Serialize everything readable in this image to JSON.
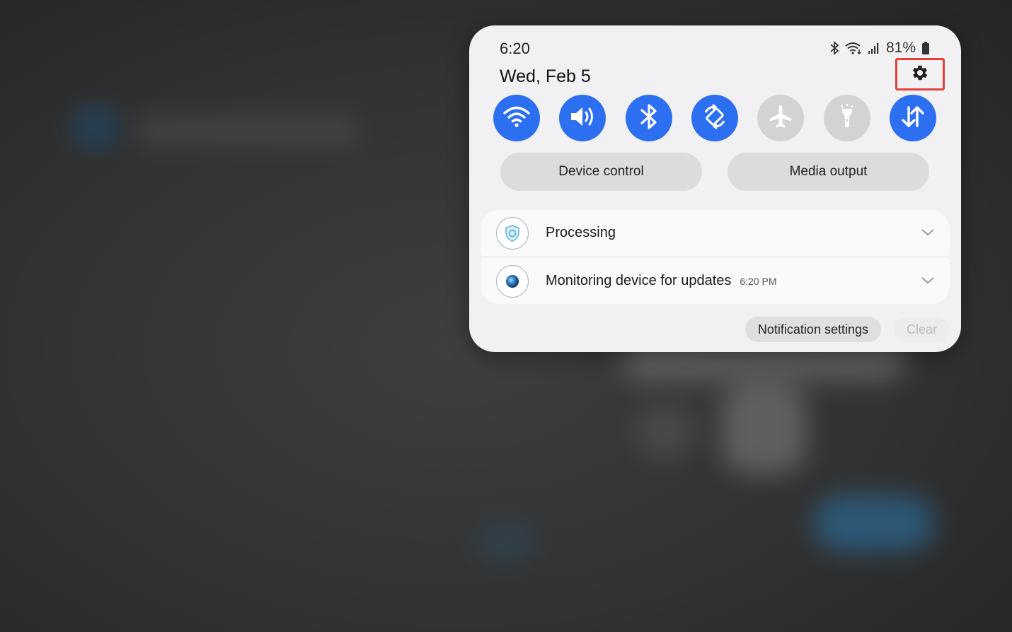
{
  "status_bar": {
    "time": "6:20",
    "date": "Wed, Feb 5",
    "battery": "81%",
    "icons": [
      "bluetooth-icon",
      "wifi-status-icon",
      "signal-icon",
      "battery-icon"
    ]
  },
  "quick_settings": {
    "accent_color": "#2c6ff0",
    "tiles": [
      {
        "name": "wifi",
        "icon": "wifi-icon",
        "on": true
      },
      {
        "name": "sound",
        "icon": "speaker-icon",
        "on": true
      },
      {
        "name": "bluetooth",
        "icon": "bluetooth-icon",
        "on": true
      },
      {
        "name": "auto-rotate",
        "icon": "rotate-icon",
        "on": true
      },
      {
        "name": "airplane-mode",
        "icon": "airplane-icon",
        "on": false
      },
      {
        "name": "flashlight",
        "icon": "flashlight-icon",
        "on": false
      },
      {
        "name": "mobile-data",
        "icon": "data-arrows-icon",
        "on": true
      }
    ],
    "device_control_label": "Device control",
    "media_output_label": "Media output"
  },
  "notifications": [
    {
      "title": "Processing",
      "time": "",
      "icon": "shield-icon"
    },
    {
      "title": "Monitoring device for updates",
      "time": "6:20 PM",
      "icon": "update-dot-icon"
    }
  ],
  "actions": {
    "notification_settings_label": "Notification settings",
    "clear_label": "Clear"
  },
  "highlight_color": "#e0413b"
}
